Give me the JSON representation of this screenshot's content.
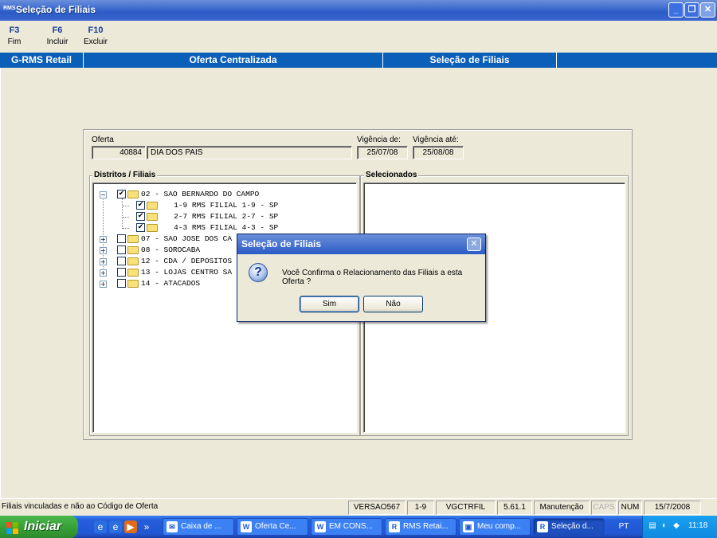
{
  "window": {
    "title": "Seleção de Filiais",
    "app_icon": "RMS"
  },
  "function_keys": [
    {
      "key": "F3",
      "label": "Fim"
    },
    {
      "key": "F6",
      "label": "Incluir"
    },
    {
      "key": "F10",
      "label": "Excluir"
    }
  ],
  "header": {
    "system": "G-RMS Retail",
    "module": "Oferta Centralizada",
    "screen": "Seleção de Filiais"
  },
  "form": {
    "oferta_label": "Oferta",
    "oferta_code": "40884",
    "oferta_desc": "DIA DOS PAIS",
    "vigencia_de_label": "Vigência de:",
    "vigencia_de": "25/07/08",
    "vigencia_ate_label": "Vigência até:",
    "vigencia_ate": "25/08/08"
  },
  "tree_panel": {
    "title": "Distritos / Filiais",
    "nodes": [
      {
        "text": "02 - SAO BERNARDO DO CAMPO",
        "expander": "−",
        "checked": "✔"
      },
      {
        "text": "   1-9 RMS FILIAL 1-9 - SP",
        "checked": "✔"
      },
      {
        "text": "   2-7 RMS FILIAL 2-7 - SP",
        "checked": "✔"
      },
      {
        "text": "   4-3 RMS FILIAL 4-3 - SP",
        "checked": "✔"
      },
      {
        "text": "07 - SAO JOSE DOS CA",
        "expander": "+",
        "checked": ""
      },
      {
        "text": "08 - SOROCABA",
        "expander": "+",
        "checked": ""
      },
      {
        "text": "12 - CDA / DEPOSITOS",
        "expander": "+",
        "checked": ""
      },
      {
        "text": "13 - LOJAS CENTRO SA",
        "expander": "+",
        "checked": ""
      },
      {
        "text": "14 - ATACADOS",
        "expander": "+",
        "checked": ""
      }
    ]
  },
  "selected_panel": {
    "title": "Selecionados"
  },
  "dialog": {
    "title": "Seleção de Filiais",
    "close": "✕",
    "icon": "?",
    "message": "Você Confirma o Relacionamento das Filiais a esta Oferta ?",
    "yes_label": "Sim",
    "no_label": "Não"
  },
  "status_bar": {
    "message": "Filiais vinculadas e não ao Código de Oferta",
    "version": "VERSAO567",
    "filial": "1-9",
    "program": "VGCTRFIL",
    "release": "5.61.1",
    "mode": "Manutenção",
    "caps": "CAPS",
    "num": "NUM",
    "date": "15/7/2008"
  },
  "taskbar": {
    "start_label": "Iniciar",
    "overflow": "»",
    "tasks": [
      {
        "label": "Caixa de ...",
        "icon": "✉"
      },
      {
        "label": "Oferta Ce...",
        "icon": "W"
      },
      {
        "label": "EM CONS...",
        "icon": "W"
      },
      {
        "label": "RMS Retai...",
        "icon": "R"
      },
      {
        "label": "Meu comp...",
        "icon": "▣"
      },
      {
        "label": "Seleção d...",
        "icon": "R"
      }
    ],
    "language": "PT",
    "clock": "11:18"
  }
}
